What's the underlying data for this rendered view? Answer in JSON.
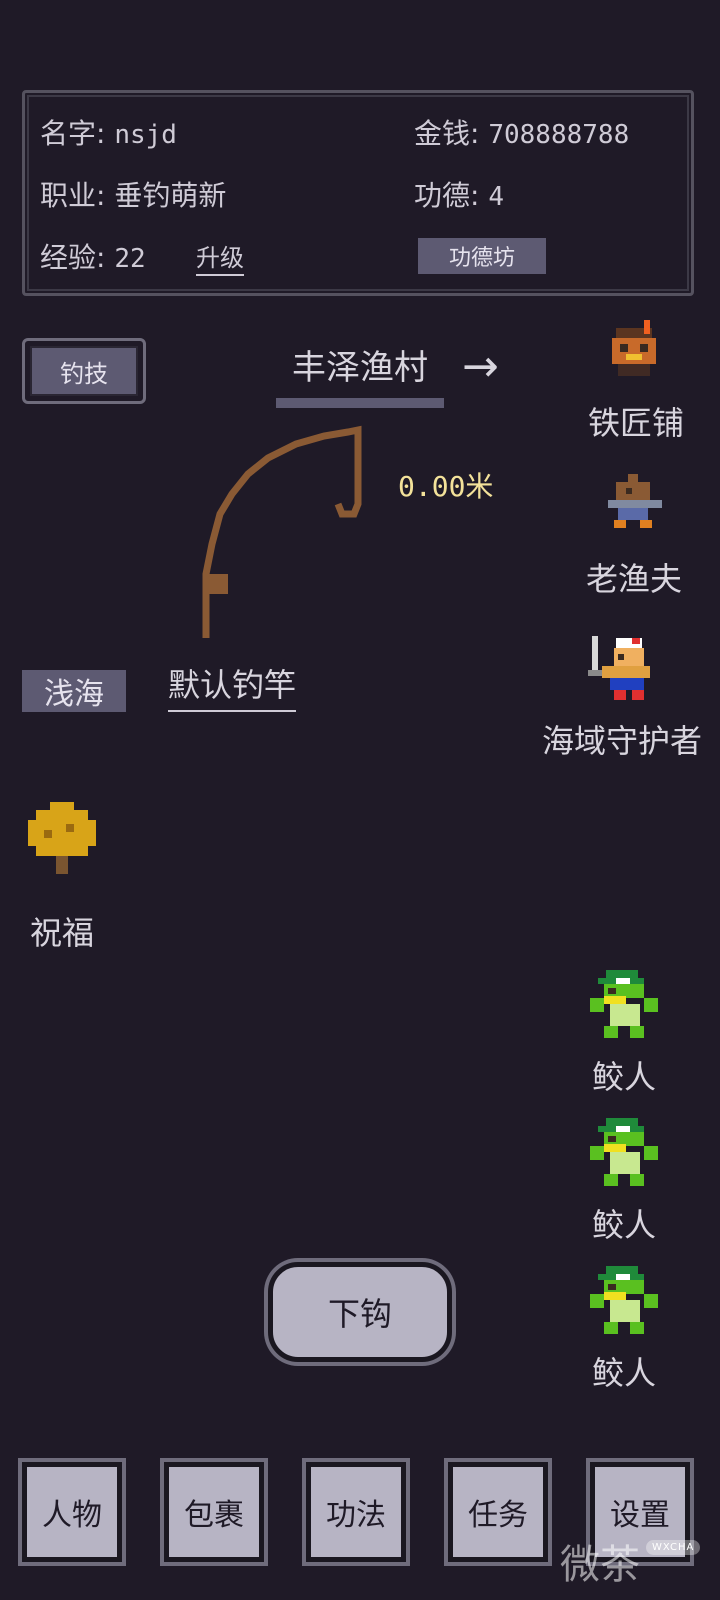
{
  "player": {
    "name_label": "名字:",
    "name_value": "nsjd",
    "money_label": "金钱:",
    "money_value": "708888788",
    "job_label": "职业:",
    "job_value": "垂钓萌新",
    "merit_label": "功德:",
    "merit_value": "4",
    "exp_label": "经验:",
    "exp_value": "22",
    "upgrade_label": "升级",
    "merit_shop_label": "功德坊"
  },
  "skills_button": "钓技",
  "location": {
    "name": "丰泽渔村",
    "arrow": "→"
  },
  "fishing": {
    "distance": "0.00米",
    "area": "浅海",
    "rod": "默认钓竿"
  },
  "npcs": [
    {
      "label": "铁匠铺",
      "icon": "blacksmith-icon"
    },
    {
      "label": "老渔夫",
      "icon": "old-fisherman-icon"
    },
    {
      "label": "海域守护者",
      "icon": "sea-guardian-icon"
    }
  ],
  "blessing": {
    "label": "祝福",
    "icon": "golden-tree-icon"
  },
  "enemies": [
    {
      "label": "鲛人",
      "icon": "merfolk-icon"
    },
    {
      "label": "鲛人",
      "icon": "merfolk-icon"
    },
    {
      "label": "鲛人",
      "icon": "merfolk-icon"
    }
  ],
  "hook_button": "下钩",
  "nav": [
    "人物",
    "包裹",
    "功法",
    "任务",
    "设置"
  ],
  "watermark": {
    "text": "微茶",
    "tag": "WXCHA"
  },
  "colors": {
    "background": "#1f1a27",
    "accent": "#5d5a72",
    "distance": "#f3e29a",
    "button": "#b7b4c4"
  }
}
